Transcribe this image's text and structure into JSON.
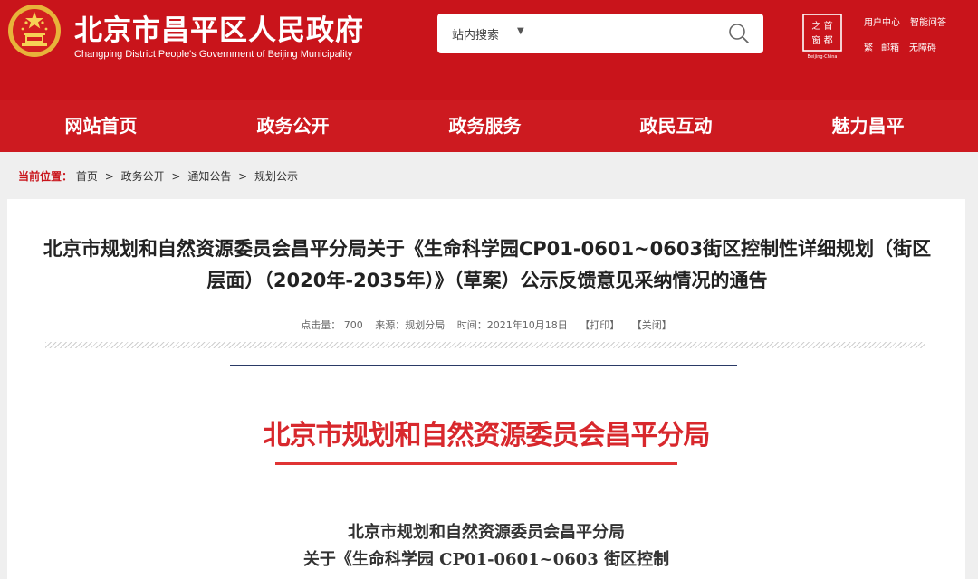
{
  "header": {
    "title": "北京市昌平区人民政府",
    "subtitle": "Changping District People's Government of Beijing Municipality",
    "search": {
      "scope_label": "站内搜索",
      "placeholder": ""
    },
    "capital_logo_text": "Beijing·China",
    "top_links": [
      "用户中心",
      "智能问答",
      "繁",
      "邮箱",
      "无障碍"
    ],
    "brand_color": "#c9141b"
  },
  "nav": {
    "items": [
      "网站首页",
      "政务公开",
      "政务服务",
      "政民互动",
      "魅力昌平"
    ]
  },
  "breadcrumb": {
    "label": "当前位置：",
    "items": [
      "首页",
      "政务公开",
      "通知公告",
      "规划公示"
    ],
    "separator": ">"
  },
  "article": {
    "title": "北京市规划和自然资源委员会昌平分局关于《生命科学园CP01-0601~0603街区控制性详细规划（街区层面）（2020年-2035年）》（草案）公示反馈意见采纳情况的通告",
    "meta": {
      "clicks": "点击量： 700",
      "source": "来源：规划分局",
      "time": "时间：2021年10月18日",
      "print": "【打印】",
      "close": "【关闭】"
    },
    "document": {
      "header": "北京市规划和自然资源委员会昌平分局",
      "line1": "北京市规划和自然资源委员会昌平分局",
      "line2": "关于《生命科学园 CP01-0601~0603 街区控制"
    }
  }
}
